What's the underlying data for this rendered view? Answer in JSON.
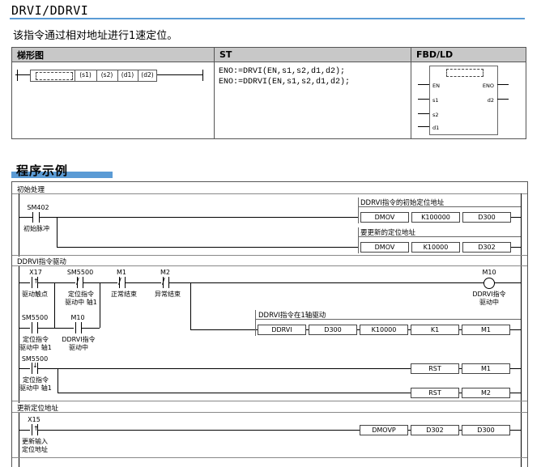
{
  "header": {
    "title": "DRVI/DDRVI",
    "description": "该指令通过相对地址进行1速定位。"
  },
  "syntax_table": {
    "headers": [
      "梯形图",
      "ST",
      "FBD/LD"
    ],
    "ladder_operands": [
      "(s1)",
      "(s2)",
      "(d1)",
      "(d2)"
    ],
    "st_lines": [
      "ENO:=DRVI(EN,s1,s2,d1,d2);",
      "ENO:=DDRVI(EN,s1,s2,d1,d2);"
    ],
    "fbd": {
      "inputs": [
        "EN",
        "s1",
        "s2",
        "d1"
      ],
      "outputs": [
        "ENO",
        "d2"
      ]
    }
  },
  "program": {
    "title": "程序示例",
    "sections": [
      {
        "title": "初始处理",
        "contact": {
          "device": "SM402",
          "comment": "初始脉冲"
        },
        "rungs": [
          {
            "comment": "DDRVI指令的初始定位地址",
            "instr": "DMOV",
            "op1": "K100000",
            "op2": "D300"
          },
          {
            "comment": "要更新的定位地址",
            "instr": "DMOV",
            "op1": "K10000",
            "op2": "D302"
          }
        ]
      },
      {
        "title": "DDRVI指令驱动",
        "contacts": [
          {
            "device": "X17",
            "comment": "驱动触点"
          },
          {
            "device": "SM5500",
            "comment": "定位指令\n驱动中 轴1"
          },
          {
            "device": "M1",
            "comment": "正常结束"
          },
          {
            "device": "M2",
            "comment": "异常结束"
          }
        ],
        "coil": {
          "device": "M10",
          "comment": "DDRVI指令\n驱动中"
        },
        "branch_contacts": [
          {
            "device": "SM5500",
            "comment": "定位指令\n驱动中 轴1"
          },
          {
            "device": "M10",
            "comment": "DDRVI指令\n驱动中"
          }
        ],
        "instr_comment": "DDRVI指令在1轴驱动",
        "instr": [
          "DDRVI",
          "D300",
          "K10000",
          "K1",
          "M1"
        ],
        "reset": {
          "contact": {
            "device": "SM5500",
            "comment": "定位指令\n驱动中 轴1"
          },
          "rows": [
            [
              "RST",
              "M1"
            ],
            [
              "RST",
              "M2"
            ]
          ]
        }
      },
      {
        "title": "更新定位地址",
        "contact": {
          "device": "X15",
          "comment": "更新输入\n定位地址"
        },
        "instr": [
          "DMOVP",
          "D302",
          "D300"
        ]
      }
    ]
  }
}
